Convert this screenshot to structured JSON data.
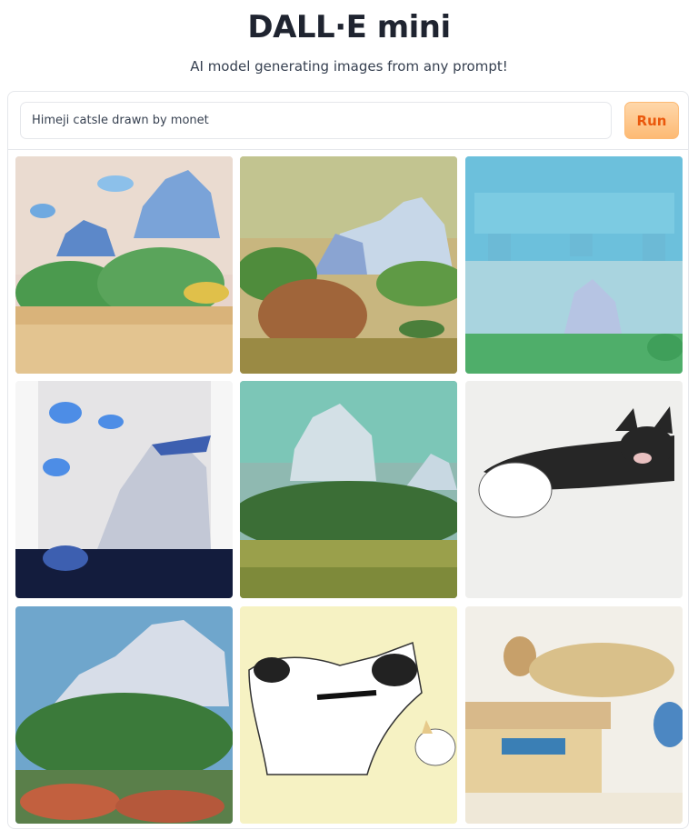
{
  "header": {
    "title": "DALL·E mini",
    "subtitle": "AI model generating images from any prompt!"
  },
  "prompt": {
    "value": "Himeji catsle drawn by monet"
  },
  "run_button": {
    "label": "Run"
  },
  "gallery": {
    "images": [
      {
        "subject": "castle",
        "palette": [
          "#f2d9c8",
          "#6b9fd4",
          "#3f8f4a",
          "#d9b070"
        ]
      },
      {
        "subject": "castle",
        "palette": [
          "#c9b784",
          "#c2d6e8",
          "#4f8a3c",
          "#a0643a"
        ]
      },
      {
        "subject": "castle",
        "palette": [
          "#9ccfdf",
          "#5fb8d6",
          "#4fae6a",
          "#dde6ea"
        ]
      },
      {
        "subject": "castle",
        "palette": [
          "#eef0f4",
          "#3d5fb0",
          "#0f1a3a",
          "#c7ccd8"
        ]
      },
      {
        "subject": "castle",
        "palette": [
          "#8fb9b1",
          "#d7e5ea",
          "#3a6a35",
          "#a9a04a"
        ]
      },
      {
        "subject": "cat",
        "palette": [
          "#f1f0ee",
          "#1c1c1c",
          "#ffffff",
          "#d6a0a0"
        ]
      },
      {
        "subject": "castle",
        "palette": [
          "#6fa6cc",
          "#d6dde7",
          "#3b7a3a",
          "#c2603f"
        ]
      },
      {
        "subject": "cat",
        "palette": [
          "#f4f0c2",
          "#111111",
          "#ffffff",
          "#e6c98a"
        ]
      },
      {
        "subject": "cat",
        "palette": [
          "#f1eee6",
          "#c7a06a",
          "#3a7fb5",
          "#e3c58c"
        ]
      }
    ]
  },
  "colors": {
    "accent": "#ea580c",
    "button_bg": "#fed7aa",
    "border": "#e5e7eb"
  }
}
